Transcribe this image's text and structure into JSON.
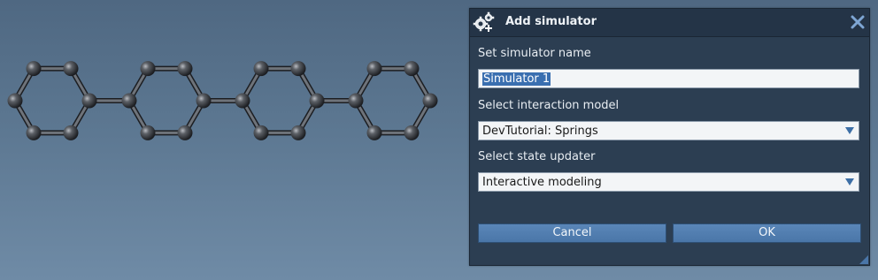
{
  "dialog": {
    "title": "Add simulator",
    "name_label": "Set simulator name",
    "name_value": "Simulator 1",
    "model_label": "Select interaction model",
    "model_value": "DevTutorial: Springs",
    "updater_label": "Select state updater",
    "updater_value": "Interactive modeling",
    "cancel_label": "Cancel",
    "ok_label": "OK"
  },
  "icons": {
    "title": "gears-add-icon",
    "close": "close-icon",
    "dropdown": "chevron-down-icon"
  },
  "colors": {
    "viewport_bg": "#5c7791",
    "dialog_bg": "#2c3e52",
    "button": "#4a76a8",
    "selection": "#3a6fb0",
    "atom": "#3a3d42"
  }
}
